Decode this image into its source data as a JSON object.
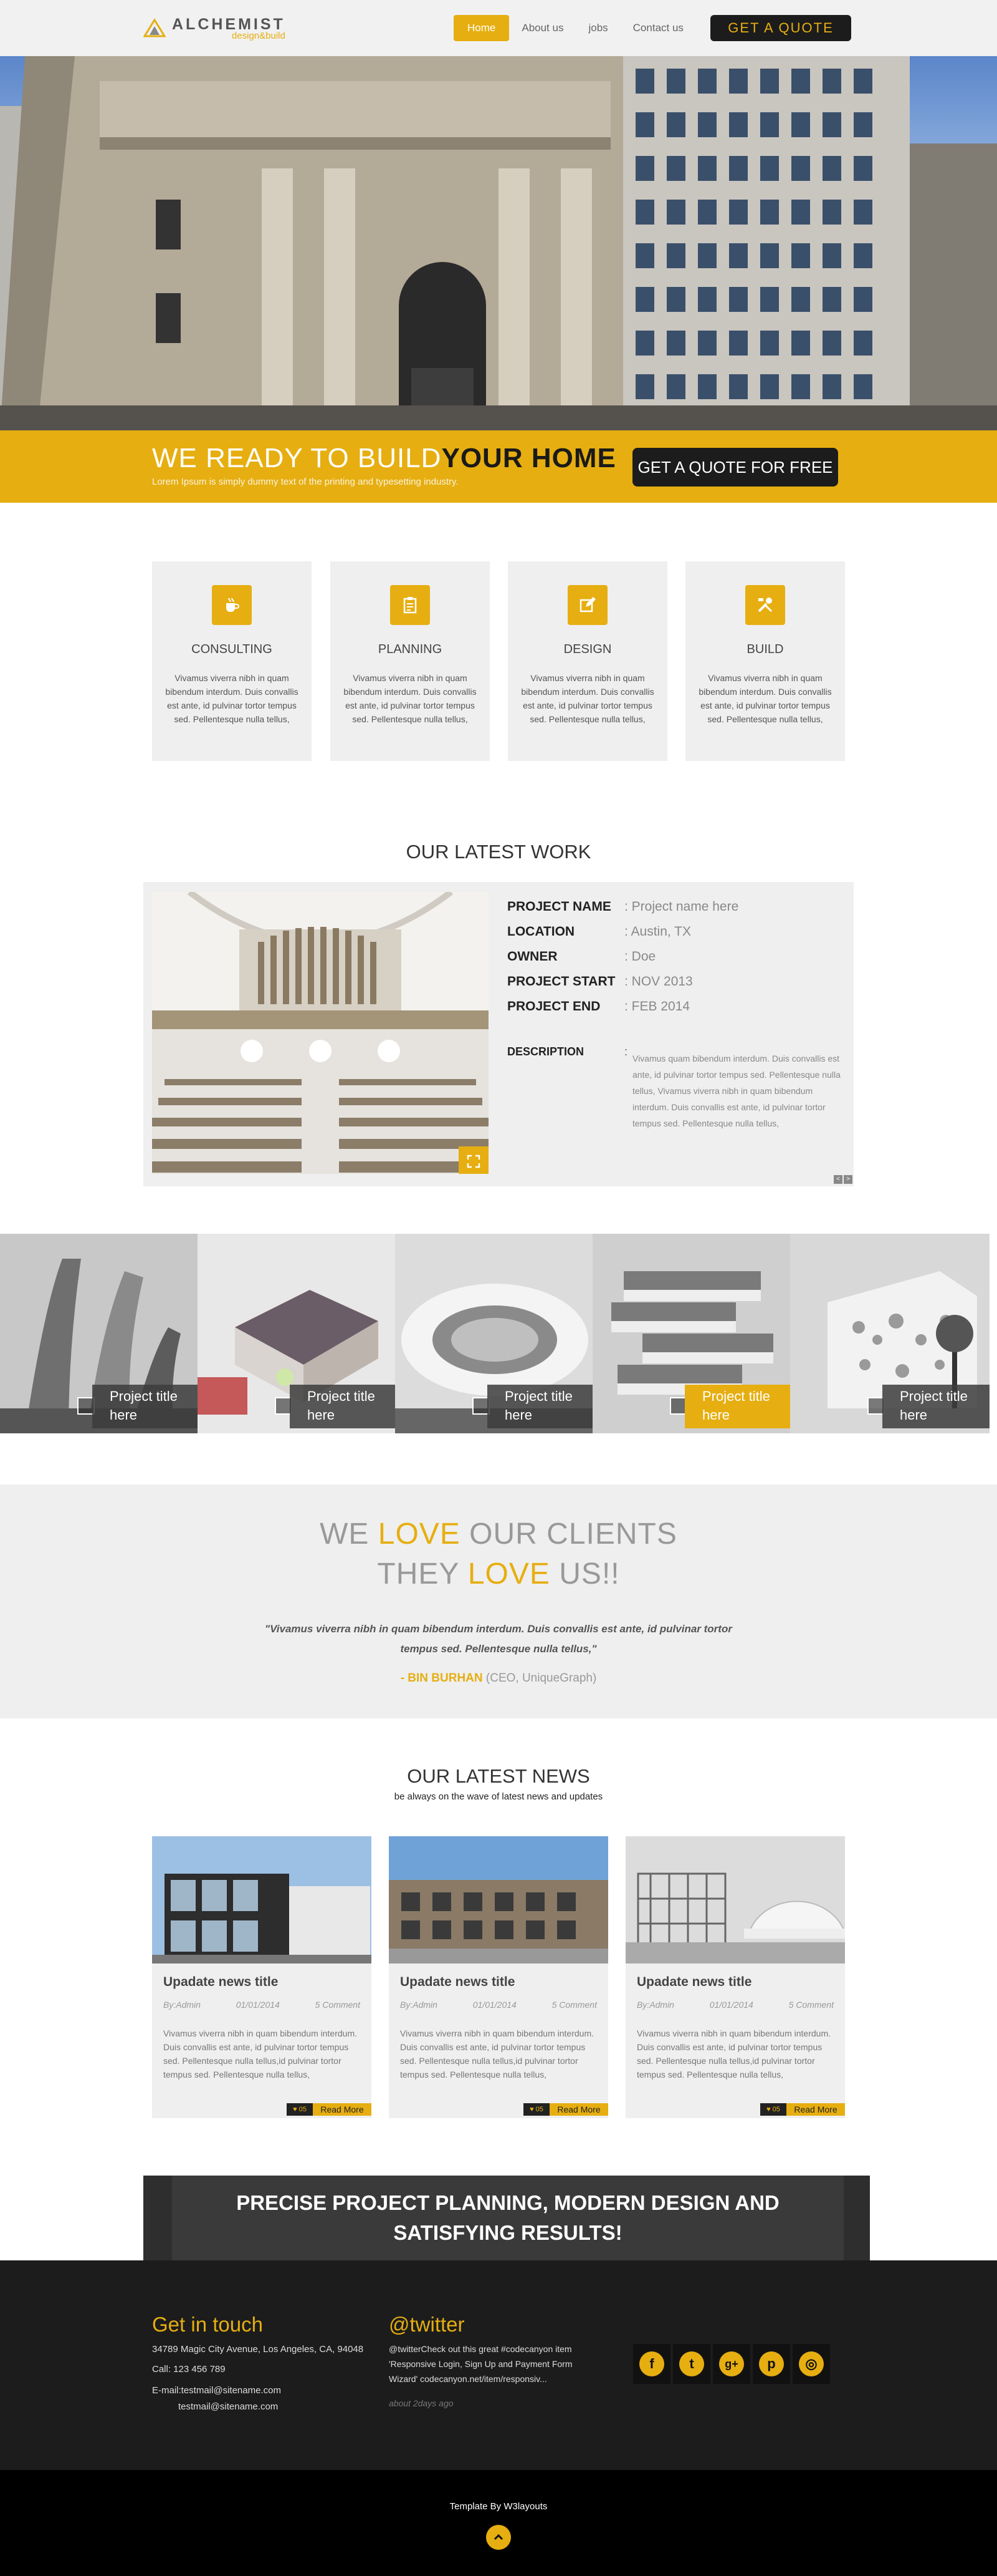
{
  "header": {
    "logo_name": "ALCHEMIST",
    "logo_sub": "design&build",
    "nav": [
      "Home",
      "About us",
      "jobs",
      "Contact us"
    ],
    "quote_button": "GET A QUOTE"
  },
  "banner": {
    "title_light": "WE READY TO BUILD",
    "title_bold": "YOUR HOME",
    "subtitle": "Lorem Ipsum is simply dummy text of the printing and typesetting industry.",
    "button": "GET A QUOTE FOR FREE"
  },
  "services": [
    {
      "title": "CONSULTING",
      "icon": "coffee-cup-icon",
      "text": "Vivamus viverra nibh in quam bibendum interdum. Duis convallis est ante, id pulvinar tortor tempus sed. Pellentesque nulla tellus,"
    },
    {
      "title": "PLANNING",
      "icon": "clipboard-icon",
      "text": "Vivamus viverra nibh in quam bibendum interdum. Duis convallis est ante, id pulvinar tortor tempus sed. Pellentesque nulla tellus,"
    },
    {
      "title": "DESIGN",
      "icon": "edit-pencil-icon",
      "text": "Vivamus viverra nibh in quam bibendum interdum. Duis convallis est ante, id pulvinar tortor tempus sed. Pellentesque nulla tellus,"
    },
    {
      "title": "BUILD",
      "icon": "tools-icon",
      "text": "Vivamus viverra nibh in quam bibendum interdum. Duis convallis est ante, id pulvinar tortor tempus sed. Pellentesque nulla tellus,"
    }
  ],
  "work": {
    "title": "OUR LATEST WORK",
    "rows": [
      {
        "label": "PROJECT NAME",
        "value": ": Project name here"
      },
      {
        "label": "LOCATION",
        "value": ": Austin, TX"
      },
      {
        "label": "OWNER",
        "value": ": Doe"
      },
      {
        "label": "PROJECT START",
        "value": ": NOV 2013"
      },
      {
        "label": "PROJECT END",
        "value": ": FEB 2014"
      }
    ],
    "desc_label": "DESCRIPTION",
    "desc_colon": ":",
    "desc_text": "Vivamus quam bibendum interdum. Duis convallis est ante, id pulvinar tortor tempus sed. Pellentesque nulla tellus, Vivamus viverra nibh in quam bibendum interdum. Duis convallis est ante, id pulvinar tortor tempus sed. Pellentesque nulla tellus,",
    "pager_prev": "<",
    "pager_next": ">"
  },
  "gallery": [
    {
      "caption": "Project title here"
    },
    {
      "caption": "Project title here"
    },
    {
      "caption": "Project title here"
    },
    {
      "caption": "Project title here"
    },
    {
      "caption": "Project title here"
    }
  ],
  "testimonial": {
    "line1_a": "WE ",
    "line1_b": "LOVE",
    "line1_c": " OUR CLIENTS",
    "line2_a": "THEY ",
    "line2_b": "LOVE",
    "line2_c": " US!!",
    "quote": "\"Vivamus viverra nibh in quam bibendum interdum. Duis convallis est ante, id pulvinar tortor tempus sed. Pellentesque nulla tellus,\"",
    "author": "- BIN BURHAN",
    "author_role": " (CEO, UniqueGraph)"
  },
  "news": {
    "title": "OUR LATEST NEWS",
    "subtitle": "be always on the wave of latest news and updates",
    "items": [
      {
        "title": "Upadate news title",
        "by": "By:Admin",
        "date": "01/01/2014",
        "comments": "5 Comment",
        "text": "Vivamus viverra nibh in quam bibendum interdum. Duis convallis est ante, id pulvinar tortor tempus sed. Pellentesque nulla tellus,id pulvinar tortor tempus sed. Pellentesque nulla tellus,",
        "likes": "05",
        "more": "Read More"
      },
      {
        "title": "Upadate news title",
        "by": "By:Admin",
        "date": "01/01/2014",
        "comments": "5 Comment",
        "text": "Vivamus viverra nibh in quam bibendum interdum. Duis convallis est ante, id pulvinar tortor tempus sed. Pellentesque nulla tellus,id pulvinar tortor tempus sed. Pellentesque nulla tellus,",
        "likes": "05",
        "more": "Read More"
      },
      {
        "title": "Upadate news title",
        "by": "By:Admin",
        "date": "01/01/2014",
        "comments": "5 Comment",
        "text": "Vivamus viverra nibh in quam bibendum interdum. Duis convallis est ante, id pulvinar tortor tempus sed. Pellentesque nulla tellus,id pulvinar tortor tempus sed. Pellentesque nulla tellus,",
        "likes": "05",
        "more": "Read More"
      }
    ]
  },
  "cta": {
    "line1": "PRECISE PROJECT PLANNING, MODERN DESIGN AND",
    "line2": "SATISFYING RESULTS!"
  },
  "footer": {
    "contact_title": "Get in touch",
    "address": "34789 Magic City Avenue, Los Angeles, CA, 94048",
    "phone": "Call: 123 456 789",
    "email1": "E-mail:testmail@sitename.com",
    "email2": "testmail@sitename.com",
    "twitter_title": "@twitter",
    "tweet": "@twitterCheck out this great #codecanyon item 'Responsive Login, Sign Up and Payment Form Wizard' codecanyon.net/item/responsiv...",
    "tweet_time": "about 2days ago",
    "social": [
      "facebook-icon",
      "twitter-icon",
      "google-plus-icon",
      "pinterest-icon",
      "dribbble-icon"
    ],
    "social_glyphs": [
      "f",
      "t",
      "g+",
      "p",
      "◎"
    ],
    "credit": "Template By W3layouts"
  },
  "colors": {
    "accent": "#e6ae10",
    "dark": "#1c1c1c",
    "panel": "#efefef"
  }
}
